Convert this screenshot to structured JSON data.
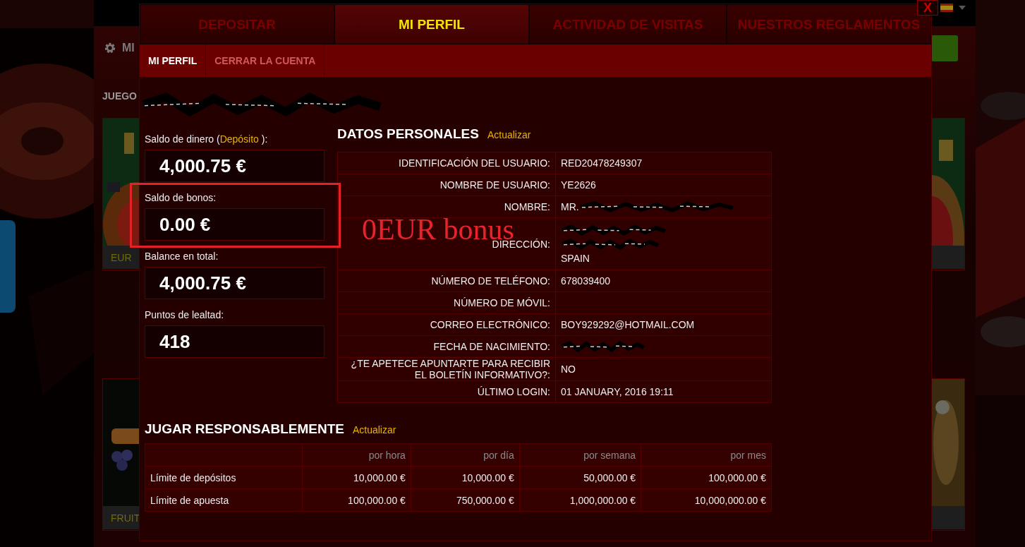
{
  "background": {
    "panel_title": "MI",
    "section_title": "JUEGO",
    "tiles": [
      {
        "caption": "EUR",
        "kind": "picture"
      },
      {
        "caption": "FRUIT",
        "kind": "picture"
      }
    ]
  },
  "close_button": {
    "label": "X"
  },
  "top_tabs": [
    {
      "label": "DEPOSITAR",
      "selected": false
    },
    {
      "label": "MI PERFIL",
      "selected": true
    },
    {
      "label": "ACTIVIDAD DE VISITAS",
      "selected": false
    },
    {
      "label": "NUESTROS REGLAMENTOS",
      "selected": false
    }
  ],
  "sub_tabs": [
    {
      "label": "MI PERFIL",
      "selected": true
    },
    {
      "label": "CERRAR LA CUENTA",
      "selected": false
    }
  ],
  "balances": [
    {
      "label": "Saldo de dinero (",
      "link": "Depósito",
      "label_end": "):",
      "value": "4,000.75 €",
      "highlighted": false
    },
    {
      "label": "Saldo de bonos:",
      "value": "0.00 €",
      "highlighted": true
    },
    {
      "label": "Balance en total:",
      "value": "4,000.75 €",
      "highlighted": false
    },
    {
      "label": "Puntos de lealtad:",
      "value": "418",
      "highlighted": false
    }
  ],
  "personal": {
    "title": "DATOS PERSONALES",
    "update_link": "Actualizar",
    "rows": [
      {
        "label": "IDENTIFICACIÓN DEL USUARIO:",
        "value": "RED20478249307",
        "kind": "text"
      },
      {
        "label": "NOMBRE DE USUARIO:",
        "value": "YE2626",
        "kind": "text"
      },
      {
        "label": "NOMBRE:",
        "value": "MR.",
        "kind": "redacted_after"
      },
      {
        "label": "DIRECCIÓN:",
        "value": "SPAIN",
        "kind": "redacted_before"
      },
      {
        "label": "NÚMERO DE TELÉFONO:",
        "value": "678039400",
        "kind": "text"
      },
      {
        "label": "NÚMERO DE MÓVIL:",
        "kind": "text"
      },
      {
        "label": "CORREO ELECTRÓNICO:",
        "value": "BOY929292@HOTMAIL.COM",
        "kind": "text"
      },
      {
        "label": "FECHA DE NACIMIENTO:",
        "kind": "redacted"
      },
      {
        "label": "¿TE APETECE APUNTARTE PARA RECIBIR EL BOLETÍN INFORMATIVO?:",
        "value": "NO",
        "kind": "text"
      },
      {
        "label": "ÚLTIMO LOGIN:",
        "value": "01 JANUARY, 2016 19:11",
        "kind": "text"
      }
    ]
  },
  "responsible": {
    "title": "JUGAR RESPONSABLEMENTE",
    "update_link": "Actualizar",
    "columns": [
      "por hora",
      "por día",
      "por semana",
      "por mes"
    ],
    "rows": [
      {
        "label": "Límite de depósitos",
        "values": [
          "10,000.00 €",
          "10,000.00 €",
          "50,000.00 €",
          "100,000.00 €"
        ]
      },
      {
        "label": "Límite de apuesta",
        "values": [
          "100,000.00 €",
          "750,000.00 €",
          "1,000,000.00 €",
          "10,000,000.00 €"
        ]
      }
    ]
  },
  "annotation": {
    "text": "0EUR bonus"
  }
}
